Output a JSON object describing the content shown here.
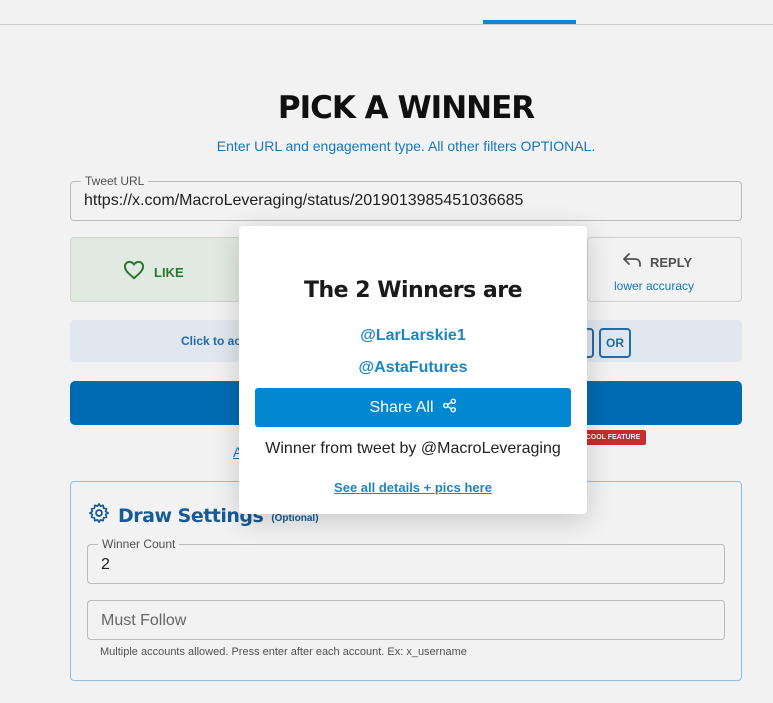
{
  "page": {
    "title": "PICK A WINNER",
    "subtitle": "Enter URL and engagement type. All other filters OPTIONAL."
  },
  "tweet_url": {
    "label": "Tweet URL",
    "value": "https://x.com/MacroLeveraging/status/2019013985451036685"
  },
  "engagement": {
    "like_label": "LIKE",
    "reply_label": "REPLY",
    "reply_note": "lower accuracy"
  },
  "filters": {
    "hint_text": "Click to ac",
    "or_label": "OR"
  },
  "advanced": {
    "link_text": "A",
    "badge": "COOL FEATURE"
  },
  "draw_settings": {
    "title": "Draw Settings",
    "optional": "(Optional)",
    "winner_count_label": "Winner Count",
    "winner_count_value": "2",
    "must_follow_placeholder": "Must Follow",
    "must_follow_help": "Multiple accounts allowed. Press enter after each account. Ex: x_username"
  },
  "modal": {
    "title": "The 2 Winners are",
    "winners": [
      "@LarLarskie1",
      "@AstaFutures"
    ],
    "share_label": "Share All",
    "source_text": "Winner from tweet by @MacroLeveraging",
    "details_link": "See all details + pics here"
  },
  "colors": {
    "accent": "#1a86c8",
    "primary_button": "#0071bc",
    "share_button": "#0288d1",
    "like_green": "#2e7d32",
    "badge_red": "#d32f2f"
  },
  "icons": [
    "heart-icon",
    "reply-icon",
    "gear-icon",
    "share-icon"
  ]
}
